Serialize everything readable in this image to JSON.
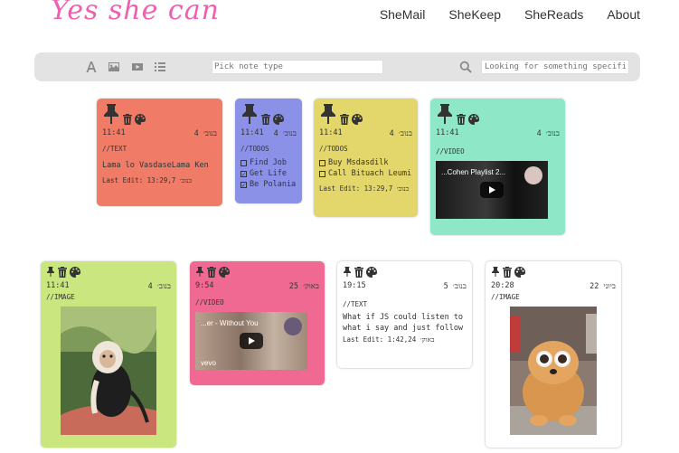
{
  "app": {
    "logo": "Yes she can"
  },
  "nav": {
    "items": [
      "SheMail",
      "SheKeep",
      "SheReads",
      "About"
    ]
  },
  "toolbar": {
    "note_type_placeholder": "Pick note type",
    "search_placeholder": "Looking for something specific?",
    "icons": [
      "text-icon",
      "image-icon",
      "video-icon",
      "list-icon",
      "search-icon"
    ]
  },
  "notes": [
    {
      "color": "#f07b66",
      "type": "//TEXT",
      "time": "11:41",
      "date": "4 בנוב׳",
      "text": "Lama lo VasdaseLama Ken",
      "edit": "Last Edit: 13:29,7 בנוב׳"
    },
    {
      "color": "#8b91e6",
      "type": "//TODOS",
      "time": "11:41",
      "date": "4 בנוב׳",
      "todos": [
        {
          "label": "Find Job",
          "done": false
        },
        {
          "label": "Get Life",
          "done": true
        },
        {
          "label": "Be Polania",
          "done": true
        }
      ]
    },
    {
      "color": "#e3d76b",
      "type": "//TODOS",
      "time": "11:41",
      "date": "4 בנוב׳",
      "todos": [
        {
          "label": "Buy Msdasdilk",
          "done": false
        },
        {
          "label": "Call Bituach Leumi",
          "done": false
        }
      ],
      "edit": "Last Edit: 13:29,7 בנוב׳"
    },
    {
      "color": "#8ee8c8",
      "type": "//VIDEO",
      "time": "11:41",
      "date": "4 בנוב׳",
      "video_title": "...Cohen Playlist 2..."
    },
    {
      "color": "#c9e67f",
      "type": "//IMAGE",
      "time": "11:41",
      "date": "4 בנוב׳"
    },
    {
      "color": "#ef6993",
      "type": "//VIDEO",
      "time": "9:54",
      "date": "25 באוק׳",
      "video_title": "...er - Without You",
      "video_brand": "vevo"
    },
    {
      "color": "#ffffff",
      "type": "//TEXT",
      "time": "19:15",
      "date": "5 בנוב׳",
      "text": "What if JS could listen to what i say and just follow",
      "edit": "Last Edit: 1:42,24 באוק׳"
    },
    {
      "color": "#ffffff",
      "type": "//IMAGE",
      "time": "20:28",
      "date": "22 ביוני"
    }
  ]
}
